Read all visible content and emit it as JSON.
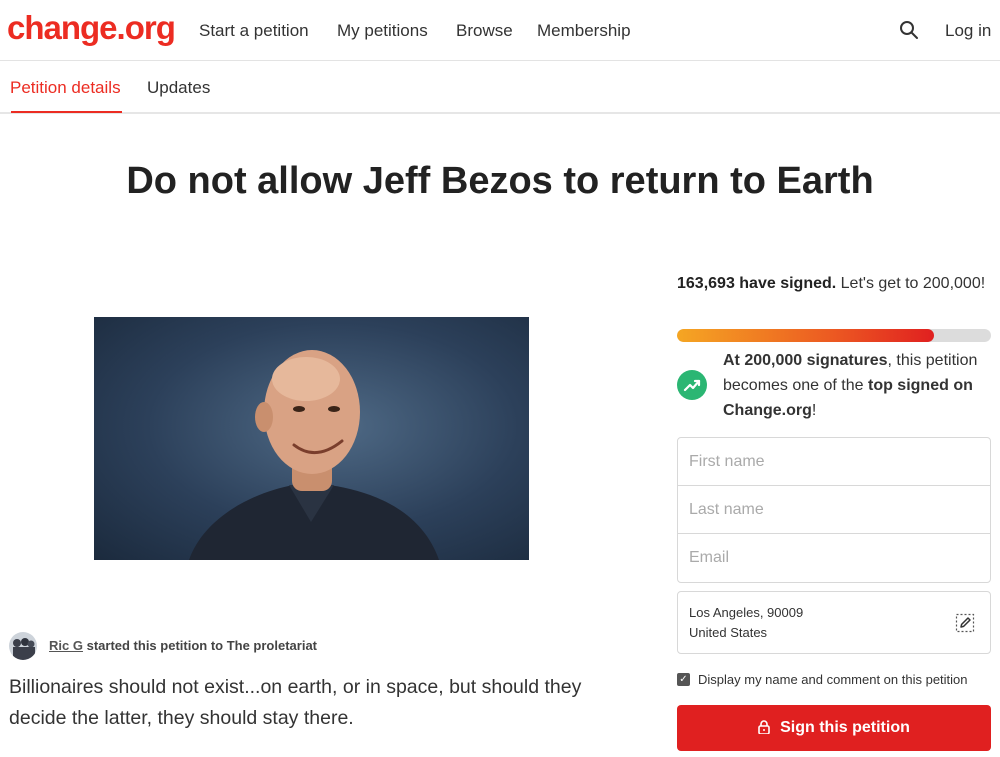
{
  "header": {
    "logo": "change.org",
    "nav": [
      "Start a petition",
      "My petitions",
      "Browse",
      "Membership"
    ],
    "search_icon": "search-icon",
    "login": "Log in"
  },
  "tabs": {
    "details": "Petition details",
    "updates": "Updates"
  },
  "petition": {
    "title": "Do not allow Jeff Bezos to return to Earth",
    "photo_icon": "petition-photo",
    "author": "Ric G",
    "started_text": "started this petition to The proletariat",
    "description": "Billionaires should not exist...on earth, or in space, but should they decide the latter, they should stay there."
  },
  "signatures": {
    "count_text": "163,693 have signed.",
    "goal_text": "Let's get to 200,000!",
    "progress_fraction": 0.82,
    "milestone_bold": "At 200,000 signatures",
    "milestone_mid": ", this petition becomes one of the ",
    "milestone_top": "top signed on Change.org",
    "milestone_end": "!",
    "milestone_icon": "trending-up-icon"
  },
  "form": {
    "first_name_placeholder": "First name",
    "last_name_placeholder": "Last name",
    "email_placeholder": "Email",
    "location_line1": "Los Angeles, 90009",
    "location_line2": "United States",
    "edit_icon": "edit-icon",
    "consent_label": "Display my name and comment on this petition",
    "consent_checked": true,
    "sign_label": "Sign this petition",
    "sign_icon": "lock-icon"
  },
  "colors": {
    "brand": "#ec2c22",
    "button": "#e02020",
    "milestone_green": "#2bb673",
    "progress_start": "#f5a623",
    "progress_end": "#e02020"
  }
}
